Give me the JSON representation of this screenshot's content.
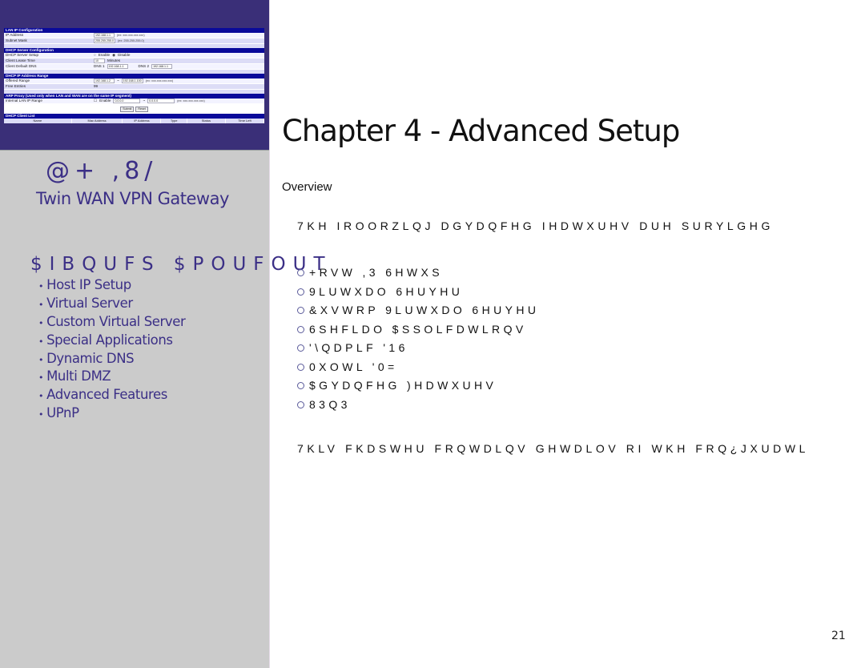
{
  "left_panel": {
    "screenshot": {
      "lan_section": "LAN IP Configuration",
      "ip_address_label": "IP Address",
      "ip_address_value": "192.168.1.1",
      "ip_address_hint": "(ex: xxx.xxx.xxx.xxx)",
      "subnet_mask_label": "Subnet Mask",
      "subnet_mask_value": "255.255.255.0",
      "subnet_mask_hint": "(ex: 255.255.255.0)",
      "dhcp_section": "DHCP Server Configuration",
      "dhcp_setup_label": "DHCP Server Setup",
      "dhcp_enable": "Enable",
      "dhcp_disable": "Disable",
      "lease_label": "Client Lease Time",
      "lease_value": "10",
      "lease_unit": "Minutes",
      "dns_label": "Client Default DNS",
      "dns1_label": "DNS 1",
      "dns1_value": "192.168.1.1",
      "dns2_label": "DNS 2",
      "dns2_value": "192.168.1.1",
      "range_section": "DHCP IP Address Range",
      "offered_label": "Offered Range",
      "offered_from": "192.168.1.2",
      "offered_to": "192.168.1.100",
      "offered_hint": "(ex: xxx.xxx.xxx.xxx)",
      "free_label": "Free Entries",
      "free_value": "99",
      "arp_section": "ARP Proxy (Used only when LAN and WAN are on the same IP segment)",
      "arp_label": "Internal LAN IP Range",
      "arp_enable": "Enable",
      "arp_from": "0.0.0.0",
      "arp_to": "0.0.0.0",
      "arp_hint": "(ex: xxx.xxx.xxx.xxx)",
      "submit": "Submit",
      "reset": "Reset",
      "client_section": "DHCP Client List",
      "client_columns": [
        "Name",
        "Mac Address",
        "IP Address",
        "Type",
        "Status",
        "Time Left"
      ]
    },
    "brand_logo": "@+ ,8/",
    "brand_subtitle": "Twin WAN VPN Gateway",
    "contents_title": "$IBQUFS $POUFOUT",
    "toc_bullet": "•",
    "toc": [
      "Host IP Setup",
      "Virtual Server",
      "Custom Virtual Server",
      "Special Applications",
      "Dynamic DNS",
      "Multi DMZ",
      "Advanced Features",
      "UPnP"
    ]
  },
  "main": {
    "chapter_title": "Chapter 4 - Advanced Setup",
    "section_heading": "Overview",
    "intro": "7KH IROORZLQJ DGYDQFHG IHDWXUHV DUH SURYLGHG",
    "features": [
      "+RVW ,3 6HWXS",
      "9LUWXDO 6HUYHU",
      "&XVWRP 9LUWXDO 6HUYHU",
      "6SHFLDO $SSOLFDWLRQV",
      "'\\QDPLF '16",
      "0XOWL '0=",
      "$GYDQFHG )HDWXUHV",
      "83Q3"
    ],
    "closing": "7KLV FKDSWHU FRQWDLQV GHWDLOV RI WKH FRQ¿JXUDWL",
    "page_number": "21"
  }
}
